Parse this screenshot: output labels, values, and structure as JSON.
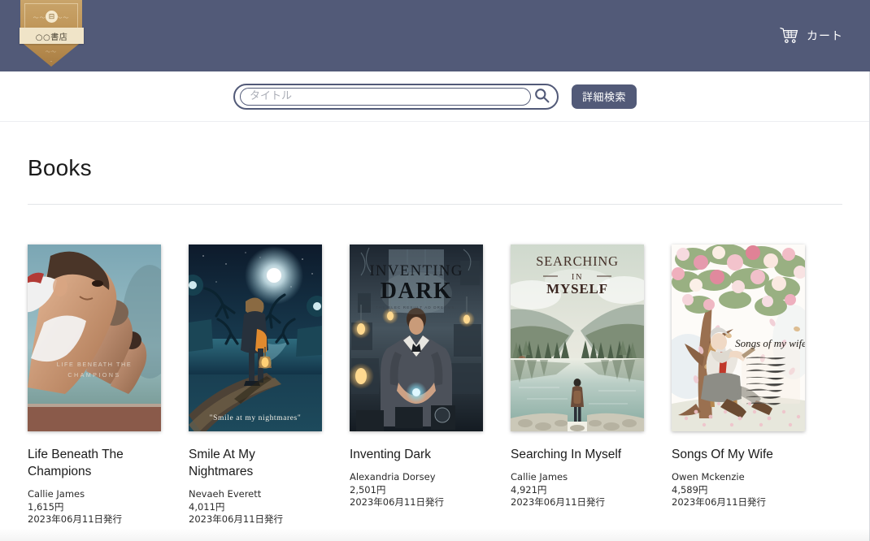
{
  "header": {
    "logo": {
      "name": "○○書店",
      "ornament_top": "〜〜 ⊞ 〜〜",
      "ornament_bottom": "〜〜",
      "book_glyph": "⊟"
    },
    "cart": {
      "label": "カート",
      "icon": "cart-icon"
    },
    "background_color": "#525a78"
  },
  "search": {
    "placeholder": "タイトル",
    "value": "",
    "search_icon": "search-icon",
    "advanced_button": "詳細検索"
  },
  "main": {
    "page_title": "Books"
  },
  "books": [
    {
      "title": "Life Beneath The Champions",
      "author": "Callie James",
      "price": "1,615円",
      "published": "2023年06月11日発行",
      "cover_alt": "runners-at-starting-line-cover",
      "cover_text": "LIFE BENEATH THE CHAMPIONS"
    },
    {
      "title": "Smile At My Nightmares",
      "author": "Nevaeh Everett",
      "price": "4,011円",
      "published": "2023年06月11日発行",
      "cover_alt": "boy-with-lantern-on-pier-cover",
      "cover_text": "\"Smile at my nightmares\""
    },
    {
      "title": "Inventing Dark",
      "author": "Alexandria Dorsey",
      "price": "2,501円",
      "published": "2023年06月11日発行",
      "cover_alt": "victorian-inventor-glowing-orb-cover",
      "cover_text": "INVENTING DARK"
    },
    {
      "title": "Searching In Myself",
      "author": "Callie James",
      "price": "4,921円",
      "published": "2023年06月11日発行",
      "cover_alt": "valley-lake-hiker-cover",
      "cover_text": "SEARCHING IN MYSELF"
    },
    {
      "title": "Songs Of My Wife",
      "author": "Owen Mckenzie",
      "price": "4,589円",
      "published": "2023年06月11日発行",
      "cover_alt": "man-writing-under-blossom-tree-cover",
      "cover_text": "Songs of my wife"
    }
  ]
}
